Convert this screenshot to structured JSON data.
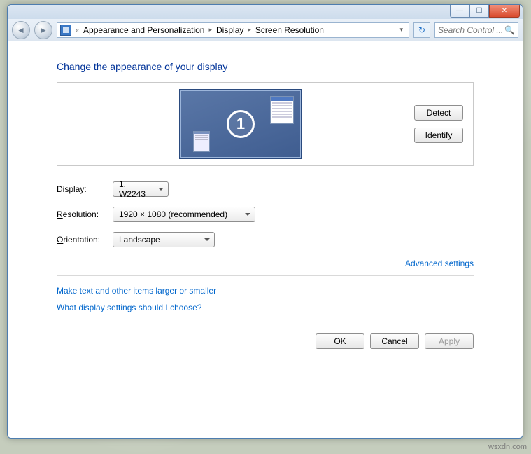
{
  "titlebar": {
    "minimize_glyph": "—",
    "maximize_glyph": "☐",
    "close_glyph": "✕"
  },
  "nav": {
    "back_glyph": "◄",
    "forward_glyph": "►",
    "prefix_glyph": "«",
    "crumb1": "Appearance and Personalization",
    "crumb2": "Display",
    "crumb3": "Screen Resolution",
    "chevron": "▸",
    "dropdown_glyph": "▾",
    "refresh_glyph": "↻",
    "search_placeholder": "Search Control ...",
    "search_icon": "🔍"
  },
  "page": {
    "title": "Change the appearance of your display",
    "monitor_number": "1",
    "detect_label": "Detect",
    "identify_label": "Identify"
  },
  "form": {
    "display_label_pre": "D",
    "display_label_post": "isplay:",
    "display_value": "1. W2243",
    "resolution_label_pre": "R",
    "resolution_label_post": "esolution:",
    "resolution_value": "1920 × 1080 (recommended)",
    "orientation_label_pre": "O",
    "orientation_label_post": "rientation:",
    "orientation_value": "Landscape"
  },
  "links": {
    "advanced": "Advanced settings",
    "larger": "Make text and other items larger or smaller",
    "which": "What display settings should I choose?"
  },
  "buttons": {
    "ok": "OK",
    "cancel": "Cancel",
    "apply": "Apply"
  },
  "watermark": "wsxdn.com"
}
